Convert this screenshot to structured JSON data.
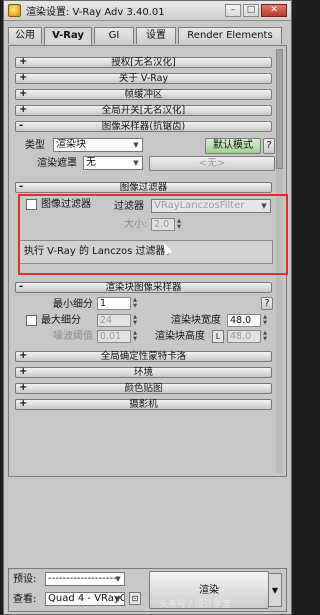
{
  "window": {
    "title": "渲染设置: V-Ray Adv 3.40.01",
    "minimize": "–",
    "maximize": "□",
    "close": "✕"
  },
  "tabs": [
    {
      "label": "公用",
      "active": false
    },
    {
      "label": "V-Ray",
      "active": true
    },
    {
      "label": "GI",
      "active": false
    },
    {
      "label": "设置",
      "active": false
    },
    {
      "label": "Render Elements",
      "active": false
    }
  ],
  "rollouts": {
    "auth": {
      "sign": "+",
      "label": "授权[无名汉化]"
    },
    "about": {
      "sign": "+",
      "label": "关于 V-Ray"
    },
    "framebuffer": {
      "sign": "+",
      "label": "帧缓冲区"
    },
    "global_switches": {
      "sign": "+",
      "label": "全局开关[无名汉化]"
    },
    "image_sampler": {
      "sign": "-",
      "label": "图像采样器(抗锯齿)"
    },
    "image_filter": {
      "sign": "-",
      "label": "图像过滤器"
    },
    "bucket_sampler": {
      "sign": "-",
      "label": "渲染块图像采样器"
    },
    "dmc": {
      "sign": "+",
      "label": "全局确定性蒙特卡洛"
    },
    "environment": {
      "sign": "+",
      "label": "环境"
    },
    "color_mapping": {
      "sign": "+",
      "label": "颜色贴图"
    },
    "camera": {
      "sign": "+",
      "label": "摄影机"
    }
  },
  "image_sampler": {
    "type_label": "类型",
    "type_value": "渲染块",
    "mask_label": "渲染遮罩",
    "mask_value": "无",
    "default_mode_button": "默认模式",
    "help_button": "?",
    "none_button": "<无>"
  },
  "image_filter": {
    "checkbox_label": "图像过滤器",
    "checked": false,
    "filter_label": "过滤器",
    "filter_value": "VRayLanczosFilter",
    "size_label": "大小:",
    "size_value": "2.0",
    "description": "执行 V-Ray 的 Lanczos 过滤器。"
  },
  "bucket_sampler": {
    "min_subdivs_label": "最小细分",
    "min_subdivs_value": "1",
    "max_subdivs_label": "最大细分",
    "max_subdivs_value": "24",
    "max_subdivs_checked": false,
    "noise_threshold_label": "噪波阈值",
    "noise_threshold_value": "0.01",
    "bucket_width_label": "渲染块宽度",
    "bucket_width_value": "48.0",
    "bucket_height_label": "渲染块高度",
    "bucket_height_lock": "L",
    "bucket_height_value": "48.0",
    "help_button": "?"
  },
  "bottom": {
    "preset_label": "预设:",
    "preset_value": "--------------------",
    "view_label": "查看:",
    "view_value": "Quad 4 - VRayC",
    "render_button": "渲染"
  },
  "watermark": "头条号 / 设计学堂"
}
